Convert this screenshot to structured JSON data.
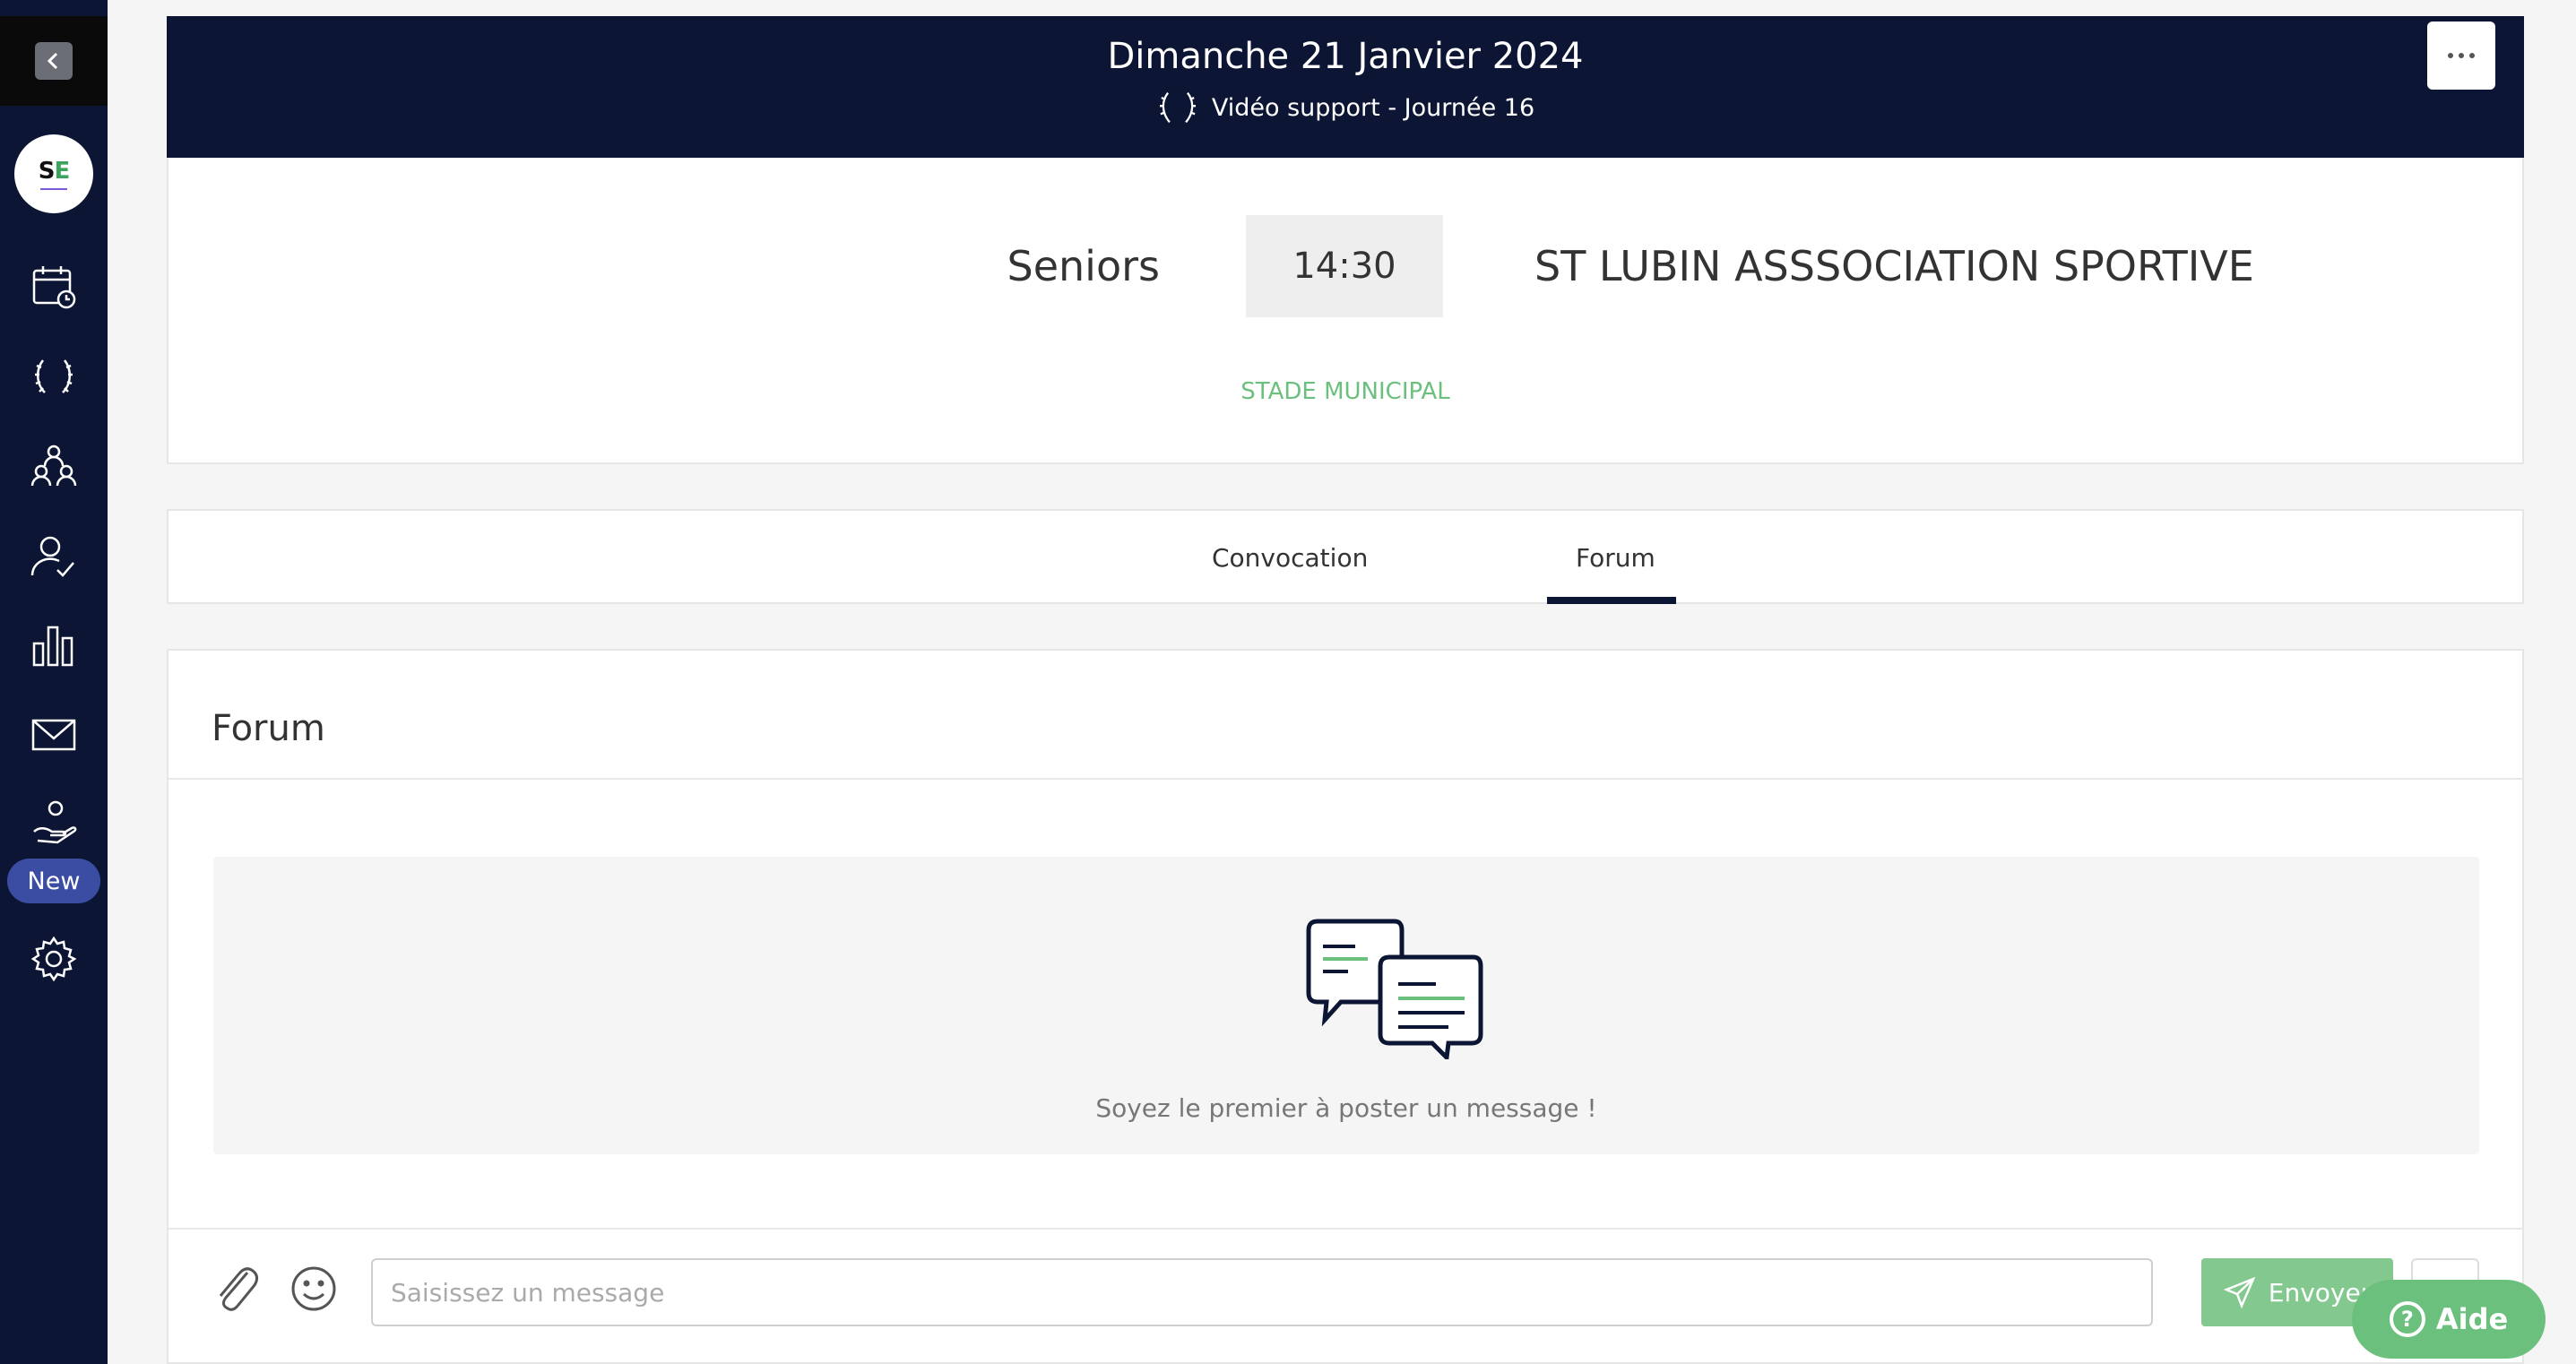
{
  "header": {
    "date": "Dimanche 21 Janvier 2024",
    "competition": "Vidéo support - Journée 16"
  },
  "match": {
    "home_team": "Seniors",
    "time": "14:30",
    "away_team": "ST LUBIN ASSSOCIATION SPORTIVE",
    "venue": "STADE MUNICIPAL"
  },
  "tabs": [
    {
      "label": "Convocation"
    },
    {
      "label": "Forum"
    }
  ],
  "active_tab": "Forum",
  "forum": {
    "title": "Forum",
    "empty_message": "Soyez le premier à poster un message !",
    "input_placeholder": "Saisissez un message",
    "send_label": "Envoyer"
  },
  "sidebar": {
    "logo_text": "SE",
    "new_badge": "New",
    "icons": [
      "calendar-clock-icon",
      "laurel-icon",
      "team-icon",
      "user-check-icon",
      "bar-chart-icon",
      "mail-icon",
      "hand-user-icon",
      "settings-icon"
    ]
  },
  "help": {
    "label": "Aide"
  },
  "colors": {
    "navy": "#0c1634",
    "accent_green": "#6cc07d",
    "send_green": "#83c98f",
    "badge_blue": "#3b4da3"
  }
}
